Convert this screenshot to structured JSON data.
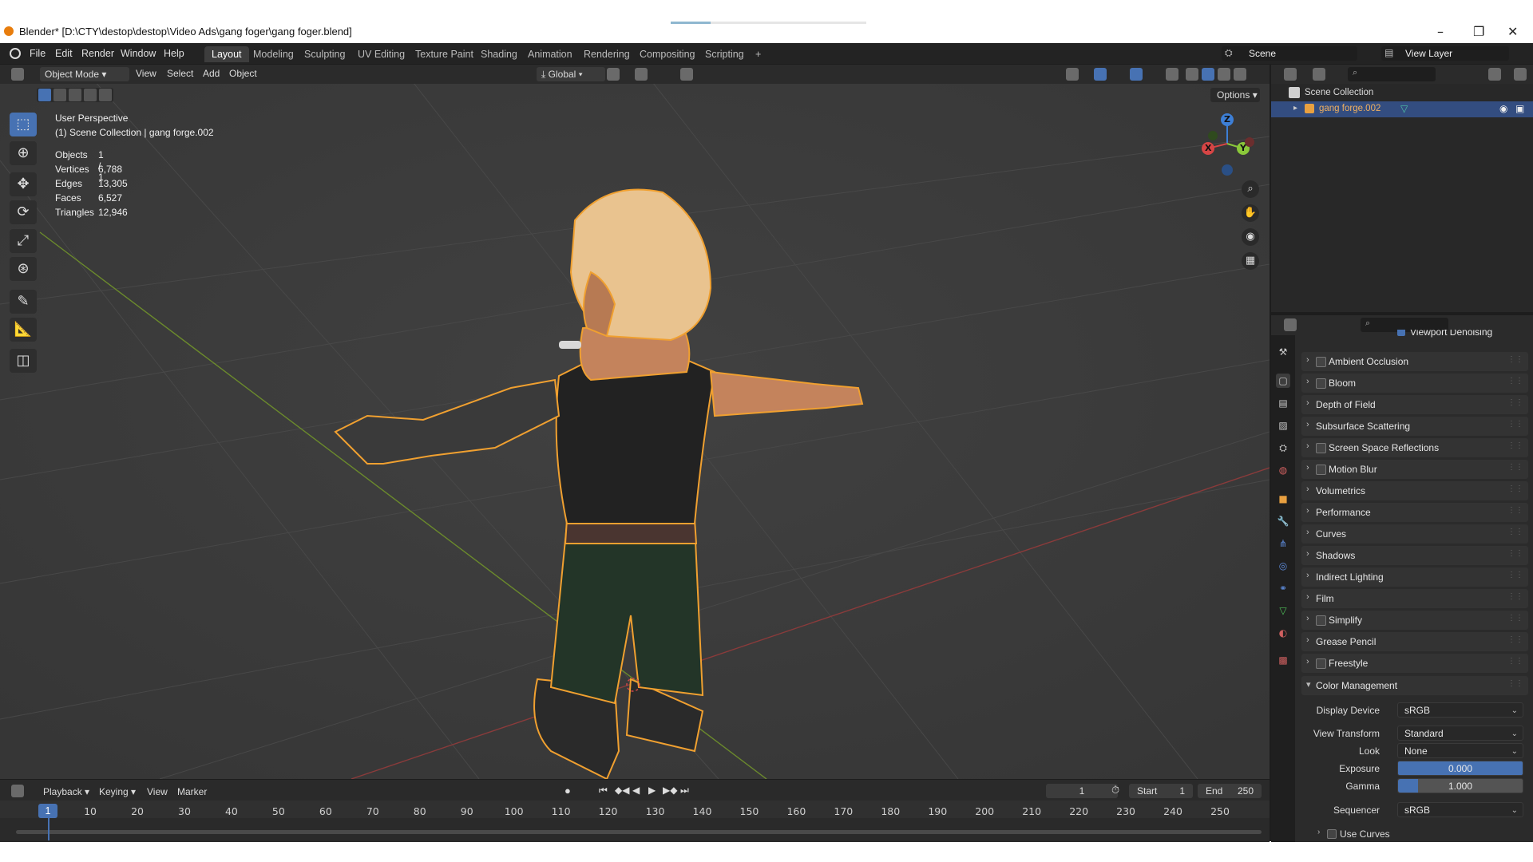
{
  "window": {
    "title": "Blender* [D:\\CTY\\destop\\destop\\Video Ads\\gang foger\\gang  foger.blend]",
    "minimize": "–",
    "restore": "❐",
    "close": "✕"
  },
  "topbar": {
    "menus": [
      "File",
      "Edit",
      "Render",
      "Window",
      "Help"
    ],
    "workspaces": [
      "Layout",
      "Modeling",
      "Sculpting",
      "UV Editing",
      "Texture Paint",
      "Shading",
      "Animation",
      "Rendering",
      "Compositing",
      "Scripting"
    ],
    "active_workspace": "Layout",
    "add_workspace": "+",
    "scene_label": "Scene",
    "view_layer_label": "View Layer"
  },
  "viewport_header": {
    "mode": "Object Mode",
    "menus": [
      "View",
      "Select",
      "Add",
      "Object"
    ],
    "orientation": "Global",
    "options": "Options"
  },
  "viewport": {
    "perspective": "User Perspective",
    "collection_info": "(1) Scene Collection | gang forge.002",
    "stats": [
      {
        "label": "Objects",
        "value": "1 / 1"
      },
      {
        "label": "Vertices",
        "value": "6,788"
      },
      {
        "label": "Edges",
        "value": "13,305"
      },
      {
        "label": "Faces",
        "value": "6,527"
      },
      {
        "label": "Triangles",
        "value": "12,946"
      }
    ],
    "gizmo_axes": [
      "Z",
      "Y",
      "X"
    ]
  },
  "outliner": {
    "root": "Scene Collection",
    "item": "gang forge.002"
  },
  "properties": {
    "clipped_top": "Viewport Denoising",
    "panels": [
      {
        "label": "Ambient Occlusion",
        "checkbox": true
      },
      {
        "label": "Bloom",
        "checkbox": true
      },
      {
        "label": "Depth of Field",
        "checkbox": false
      },
      {
        "label": "Subsurface Scattering",
        "checkbox": false
      },
      {
        "label": "Screen Space Reflections",
        "checkbox": true
      },
      {
        "label": "Motion Blur",
        "checkbox": true
      },
      {
        "label": "Volumetrics",
        "checkbox": false
      },
      {
        "label": "Performance",
        "checkbox": false
      },
      {
        "label": "Curves",
        "checkbox": false
      },
      {
        "label": "Shadows",
        "checkbox": false
      },
      {
        "label": "Indirect Lighting",
        "checkbox": false
      },
      {
        "label": "Film",
        "checkbox": false
      },
      {
        "label": "Simplify",
        "checkbox": true
      },
      {
        "label": "Grease Pencil",
        "checkbox": false
      },
      {
        "label": "Freestyle",
        "checkbox": true
      }
    ],
    "color_management": {
      "title": "Color Management",
      "display_device_label": "Display Device",
      "display_device": "sRGB",
      "view_transform_label": "View Transform",
      "view_transform": "Standard",
      "look_label": "Look",
      "look": "None",
      "exposure_label": "Exposure",
      "exposure": "0.000",
      "gamma_label": "Gamma",
      "gamma": "1.000",
      "gamma_fill": 0.16,
      "sequencer_label": "Sequencer",
      "sequencer": "sRGB",
      "use_curves": "Use Curves"
    }
  },
  "timeline": {
    "menus": [
      "Playback",
      "Keying",
      "View",
      "Marker"
    ],
    "current_frame": "1",
    "start_label": "Start",
    "start": "1",
    "end_label": "End",
    "end": "250",
    "ticks": [
      "1",
      "10",
      "20",
      "30",
      "40",
      "50",
      "60",
      "70",
      "80",
      "90",
      "100",
      "110",
      "120",
      "130",
      "140",
      "150",
      "160",
      "170",
      "180",
      "190",
      "200",
      "210",
      "220",
      "230",
      "240",
      "250"
    ]
  },
  "colors": {
    "accent": "#4772b3",
    "selection_outline": "#f0a030",
    "viewport_bg": "#3b3b3b"
  }
}
